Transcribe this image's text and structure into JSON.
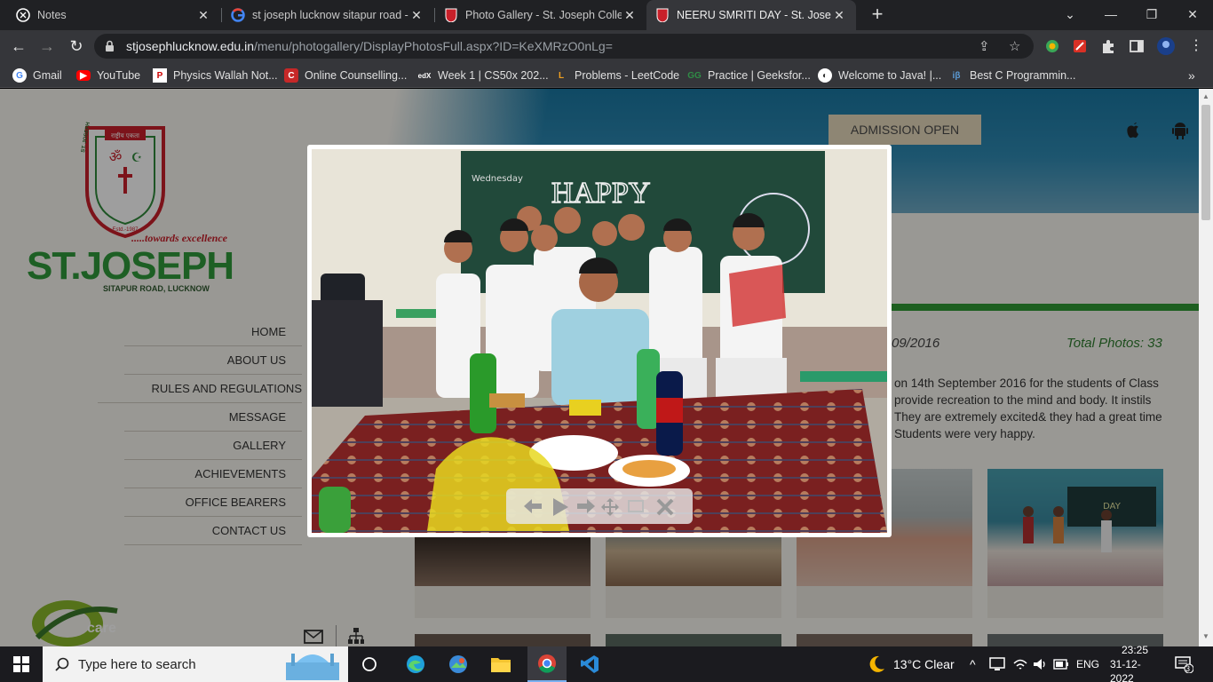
{
  "tabs": [
    {
      "title": "Notes",
      "active": false
    },
    {
      "title": "st joseph lucknow sitapur road -",
      "active": false
    },
    {
      "title": "Photo Gallery - St. Joseph Colleg",
      "active": false
    },
    {
      "title": "NEERU SMRITI DAY - St. Joseph C",
      "active": true
    }
  ],
  "address": {
    "host": "stjosephlucknow.edu.in",
    "path": "/menu/photogallery/DisplayPhotosFull.aspx?ID=KeXMRzO0nLg="
  },
  "bookmarks": [
    "Gmail",
    "YouTube",
    "Physics Wallah Not...",
    "Online Counselling...",
    "Week 1 | CS50x 202...",
    "Problems - LeetCode",
    "Practice | Geeksfor...",
    "Welcome to Java! |...",
    "Best C Programmin..."
  ],
  "header": {
    "admission": "ADMISSION OPEN"
  },
  "logo": {
    "motto": "राष्ट्रीय एकता",
    "ring": "ST. JOSEPH GROUP OF INSTITUTIONS",
    "estd": "Estd.-1987",
    "tagline": ".....towards excellence",
    "name": "ST.JOSEPH",
    "location": "SITAPUR ROAD, LUCKNOW"
  },
  "menu": [
    "HOME",
    "ABOUT US",
    "RULES AND REGULATIONS",
    "MESSAGE",
    "GALLERY",
    "ACHIEVEMENTS",
    "OFFICE BEARERS",
    "CONTACT US"
  ],
  "gallery": {
    "date": "09/2016",
    "total": "Total Photos: 33",
    "description": "on 14th September 2016 for the students of Class provide recreation to the mind and body. It instils They are extremely excited& they had a great time Students were very happy."
  },
  "care_logo": "care",
  "board_text": {
    "day": "Wednesday",
    "greeting": "HAPPY"
  },
  "lightbox": {
    "controls": [
      "previous-icon",
      "play-icon",
      "next-icon",
      "move-icon",
      "fullscreen-icon",
      "close-icon"
    ]
  },
  "taskbar": {
    "search_placeholder": "Type here to search",
    "weather": "13°C  Clear",
    "lang": "ENG",
    "time": "23:25",
    "date": "31-12-2022",
    "notifications": "3"
  },
  "colors": {
    "chrome_dark": "#202124",
    "chrome_mid": "#35363a",
    "accent_green": "#2f9a35",
    "banner_blue": "#2f8ab3"
  }
}
